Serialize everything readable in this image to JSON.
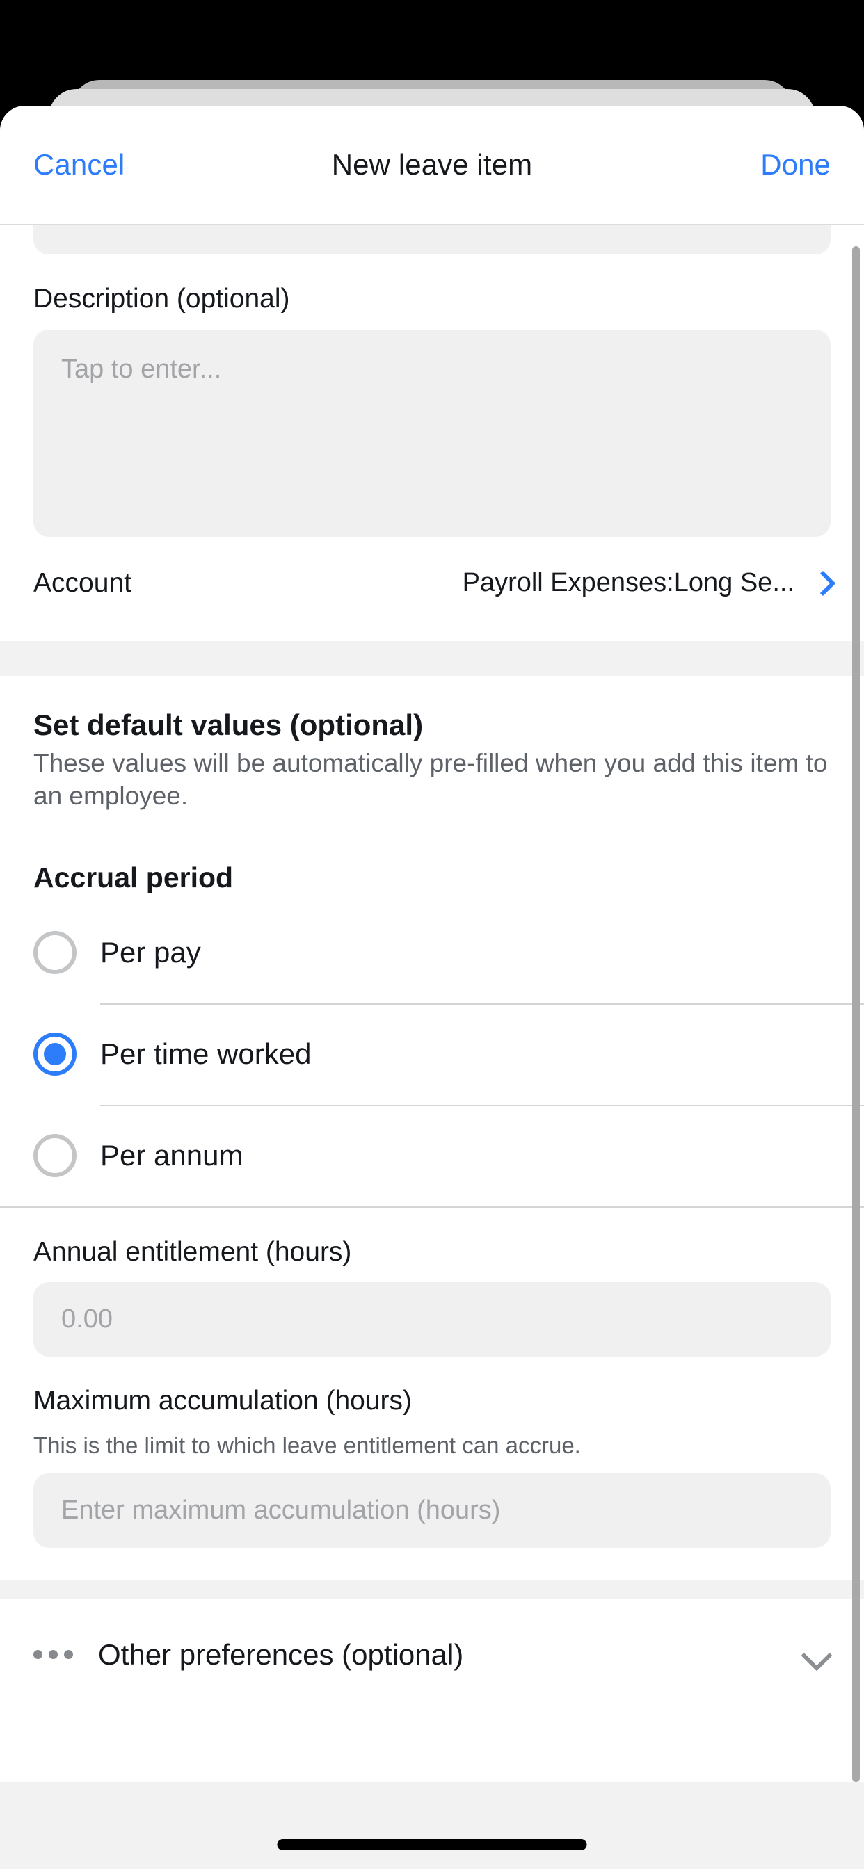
{
  "navbar": {
    "cancel_label": "Cancel",
    "title": "New leave item",
    "done_label": "Done"
  },
  "form": {
    "description": {
      "label": "Description (optional)",
      "placeholder": "Tap to enter...",
      "value": ""
    },
    "account": {
      "label": "Account",
      "value": "Payroll Expenses:Long Se...",
      "chevron": "chevron-right-icon"
    }
  },
  "defaults_section": {
    "title": "Set default values (optional)",
    "description": "These values will be automatically pre-filled when you add this item to an employee.",
    "accrual_period": {
      "title": "Accrual period",
      "options": [
        {
          "label": "Per pay",
          "selected": false
        },
        {
          "label": "Per time worked",
          "selected": true
        },
        {
          "label": "Per annum",
          "selected": false
        }
      ]
    },
    "annual_entitlement": {
      "label": "Annual entitlement (hours)",
      "placeholder": "0.00",
      "value": ""
    },
    "maximum_accumulation": {
      "label": "Maximum accumulation (hours)",
      "hint": "This is the limit to which leave entitlement can accrue.",
      "placeholder": "Enter maximum accumulation (hours)",
      "value": ""
    }
  },
  "other_preferences": {
    "label": "Other preferences (optional)",
    "leading_icon": "more-dots-icon",
    "trailing_icon": "chevron-down-icon"
  },
  "colors": {
    "accent": "#2d7dfb",
    "text_primary": "#15181c",
    "text_secondary": "#5d6268",
    "placeholder": "#a2a4a8",
    "field_background": "#f0f0f0",
    "group_gap": "#f2f2f2",
    "divider": "#d4d4d4",
    "radio_unselected": "#c3c5c7"
  }
}
